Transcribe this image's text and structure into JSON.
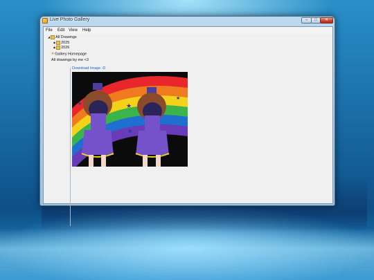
{
  "window": {
    "title": "Live Photo Gallery",
    "buttons": {
      "minimize": "–",
      "maximize": "□",
      "close": "✕"
    }
  },
  "menu": [
    "File",
    "Edit",
    "View",
    "Help"
  ],
  "tree": {
    "root": "All Drawings",
    "children": [
      "2025",
      "2026"
    ],
    "homepage": "Gallery Homepage"
  },
  "caption": "All drawings by me <3",
  "download_link": "Download Image :D",
  "photo": {
    "description_icon": "image-drawing",
    "colors": {
      "rainbow": [
        "#e8262c",
        "#f07a1e",
        "#f4d21a",
        "#3bb54a",
        "#1f6fd1",
        "#6a3bb8"
      ],
      "hair": "#8a4a2c",
      "dress": "#7552c9",
      "hat": "#4a3f9e"
    }
  },
  "colors": {
    "accent_link": "#1a63c6",
    "close_button": "#c9442c"
  }
}
